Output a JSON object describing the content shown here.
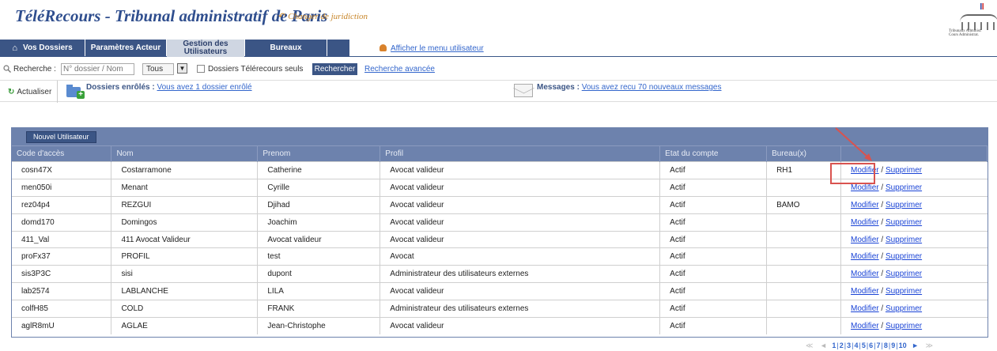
{
  "header": {
    "app_title": "TéléRecours - Tribunal administratif de Paris",
    "change_jurisdiction": "Changer de juridiction",
    "logo_caption_1": "Tribunaux Administ.",
    "logo_caption_2": "Cours Administrat."
  },
  "nav": {
    "tabs": [
      {
        "label": "Vos Dossiers"
      },
      {
        "label": "Paramètres Acteur"
      },
      {
        "label": "Gestion des Utilisateurs"
      },
      {
        "label": "Bureaux"
      }
    ],
    "user_menu": "Afficher le menu utilisateur"
  },
  "search": {
    "label": "Recherche :",
    "placeholder": "N° dossier / Nom",
    "filter_value": "Tous",
    "checkbox_label": "Dossiers Télérecours seuls",
    "submit_label": "Rechercher",
    "advanced_label": "Recherche avancée"
  },
  "info": {
    "refresh_label": "Actualiser",
    "enrolled_label": "Dossiers enrôlés :",
    "enrolled_link": "Vous avez 1 dossier enrôlé",
    "messages_label": "Messages :",
    "messages_link": "Vous avez recu 70 nouveaux messages"
  },
  "users_table": {
    "new_user_button": "Nouvel Utilisateur",
    "columns": [
      "Code d'accès",
      "Nom",
      "Prenom",
      "Profil",
      "Etat du compte",
      "Bureau(x)",
      ""
    ],
    "action_modify": "Modifier",
    "action_separator": "/",
    "action_delete": "Supprimer",
    "rows": [
      [
        "cosn47X",
        "Costarramone",
        "Catherine",
        "Avocat valideur",
        "Actif",
        "RH1"
      ],
      [
        "men050i",
        "Menant",
        "Cyrille",
        "Avocat valideur",
        "Actif",
        ""
      ],
      [
        "rez04p4",
        "REZGUI",
        "Djihad",
        "Avocat valideur",
        "Actif",
        "BAMO"
      ],
      [
        "domd170",
        "Domingos",
        "Joachim",
        "Avocat valideur",
        "Actif",
        ""
      ],
      [
        "411_Val",
        "411 Avocat Valideur",
        "Avocat valideur",
        "Avocat valideur",
        "Actif",
        ""
      ],
      [
        "proFx37",
        "PROFIL",
        "test",
        "Avocat",
        "Actif",
        ""
      ],
      [
        "sis3P3C",
        "sisi",
        "dupont",
        "Administrateur des utilisateurs externes",
        "Actif",
        ""
      ],
      [
        "lab2574",
        "LABLANCHE",
        "LILA",
        "Avocat valideur",
        "Actif",
        ""
      ],
      [
        "colfH85",
        "COLD",
        "FRANK",
        "Administrateur des utilisateurs externes",
        "Actif",
        ""
      ],
      [
        "aglR8mU",
        "AGLAE",
        "Jean-Christophe",
        "Avocat valideur",
        "Actif",
        ""
      ]
    ]
  },
  "pagination": {
    "first": "≪",
    "prev": "◄",
    "pages": [
      "1",
      "2",
      "3",
      "4",
      "5",
      "6",
      "7",
      "8",
      "9",
      "10"
    ],
    "next": "►",
    "last": "≫"
  },
  "colors": {
    "nav_blue": "#3b5585",
    "table_header": "#6d82ad",
    "title_blue": "#2f4e8e",
    "link": "#1a44d6",
    "highlight": "#d9534f"
  }
}
